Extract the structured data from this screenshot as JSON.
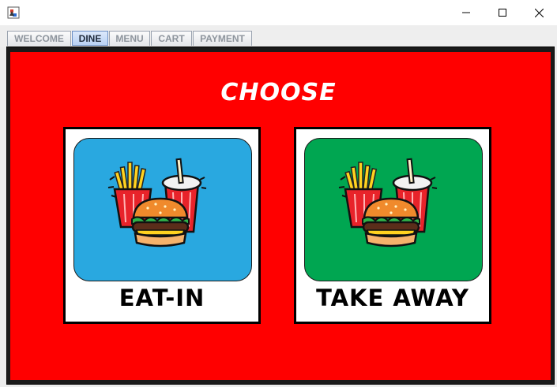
{
  "window": {
    "controls": {
      "minimize_icon": "minimize-icon",
      "maximize_icon": "maximize-icon",
      "close_icon": "close-icon"
    }
  },
  "tabs": [
    {
      "label": "WELCOME",
      "selected": false
    },
    {
      "label": "DINE",
      "selected": true
    },
    {
      "label": "MENU",
      "selected": false
    },
    {
      "label": "CART",
      "selected": false
    },
    {
      "label": "PAYMENT",
      "selected": false
    }
  ],
  "dine": {
    "heading": "CHOOSE",
    "options": [
      {
        "label": "EAT-IN",
        "tile_color": "#29a8e0",
        "icon": "fast-food-icon"
      },
      {
        "label": "TAKE AWAY",
        "tile_color": "#00a651",
        "icon": "fast-food-icon"
      }
    ]
  },
  "colors": {
    "panel_background": "#ff0000",
    "heading_text": "#ffffff",
    "selected_tab": "#c6d9f5"
  }
}
